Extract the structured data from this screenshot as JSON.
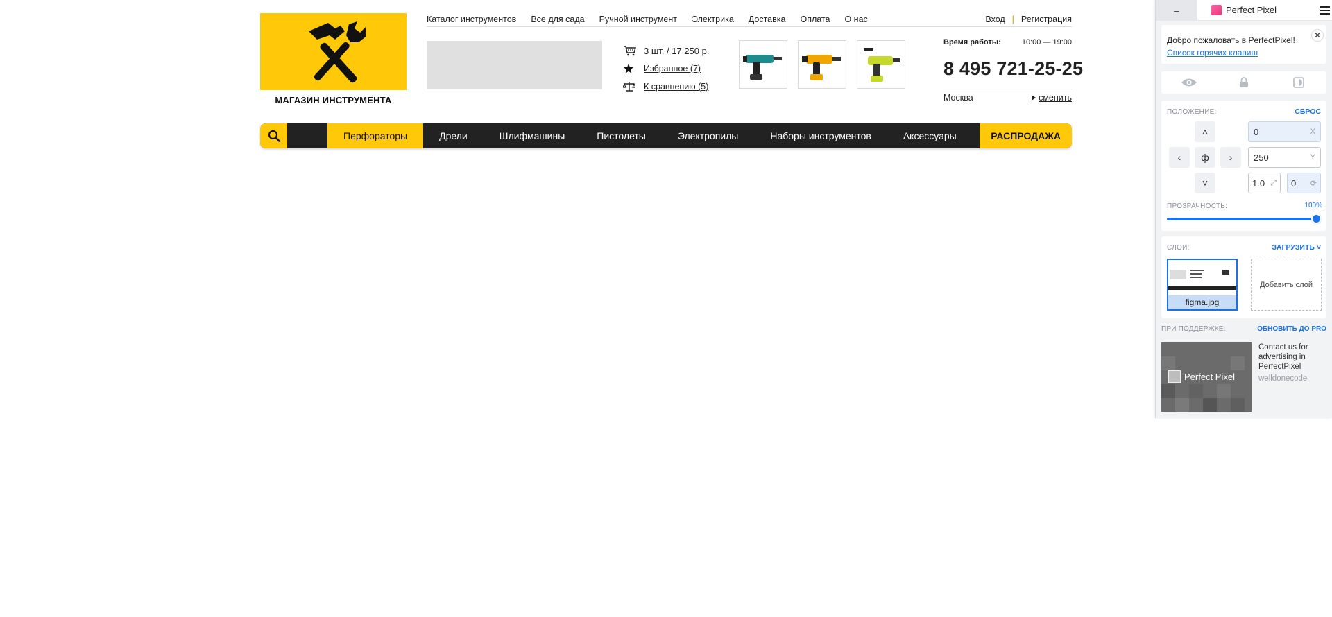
{
  "logo": {
    "caption": "МАГАЗИН ИНСТРУМЕНТА",
    "bg": "#ffc90a",
    "icon": "hammer-wrench-icon"
  },
  "top_nav": {
    "links": [
      "Каталог инструментов",
      "Все для сада",
      "Ручной инструмент",
      "Электрика",
      "Доставка",
      "Оплата",
      "О нас"
    ],
    "login": "Вход",
    "separator": "|",
    "register": "Регистрация"
  },
  "user_links": {
    "cart": "3 шт. / 17 250 р.",
    "favorites": "Избранное (7)",
    "compare": "К сравнению (5)"
  },
  "contacts": {
    "worktime_label": "Время работы:",
    "worktime_value": "10:00 — 19:00",
    "phone": "8 495 721-25-25",
    "city": "Москва",
    "change_city": "сменить"
  },
  "menu": {
    "items": [
      "Перфораторы",
      "Дрели",
      "Шлифмашины",
      "Пистолеты",
      "Электропилы",
      "Наборы инструментов",
      "Аксессуары"
    ],
    "active_index": 0,
    "sale": "РАСПРОДАЖА"
  },
  "perfectpixel": {
    "minimize": "–",
    "title": "Perfect Pixel",
    "welcome": "Добро пожаловать в PerfectPixel!",
    "hotkeys_link": "Список горячих клавиш",
    "position_label": "ПОЛОЖЕНИЕ:",
    "reset": "СБРОС",
    "center_glyph": "ф",
    "x_value": "0",
    "x_suffix": "X",
    "y_value": "250",
    "y_suffix": "Y",
    "scale_value": "1.0",
    "rotation_value": "0",
    "opacity_label": "ПРОЗРАЧНОСТЬ:",
    "opacity_value": "100%",
    "opacity_fraction": 1.0,
    "layers_label": "СЛОИ:",
    "upload": "ЗАГРУЗИТЬ",
    "layer_name": "figma.jpg",
    "add_layer": "Добавить слой",
    "support_label": "ПРИ ПОДДЕРЖКЕ:",
    "upgrade": "ОБНОВИТЬ ДО PRO",
    "ad_logo_text": "Perfect Pixel",
    "ad_text": "Contact us for advertising in PerfectPixel",
    "ad_brand": "welldonecode",
    "accent": "#1a73e8"
  }
}
